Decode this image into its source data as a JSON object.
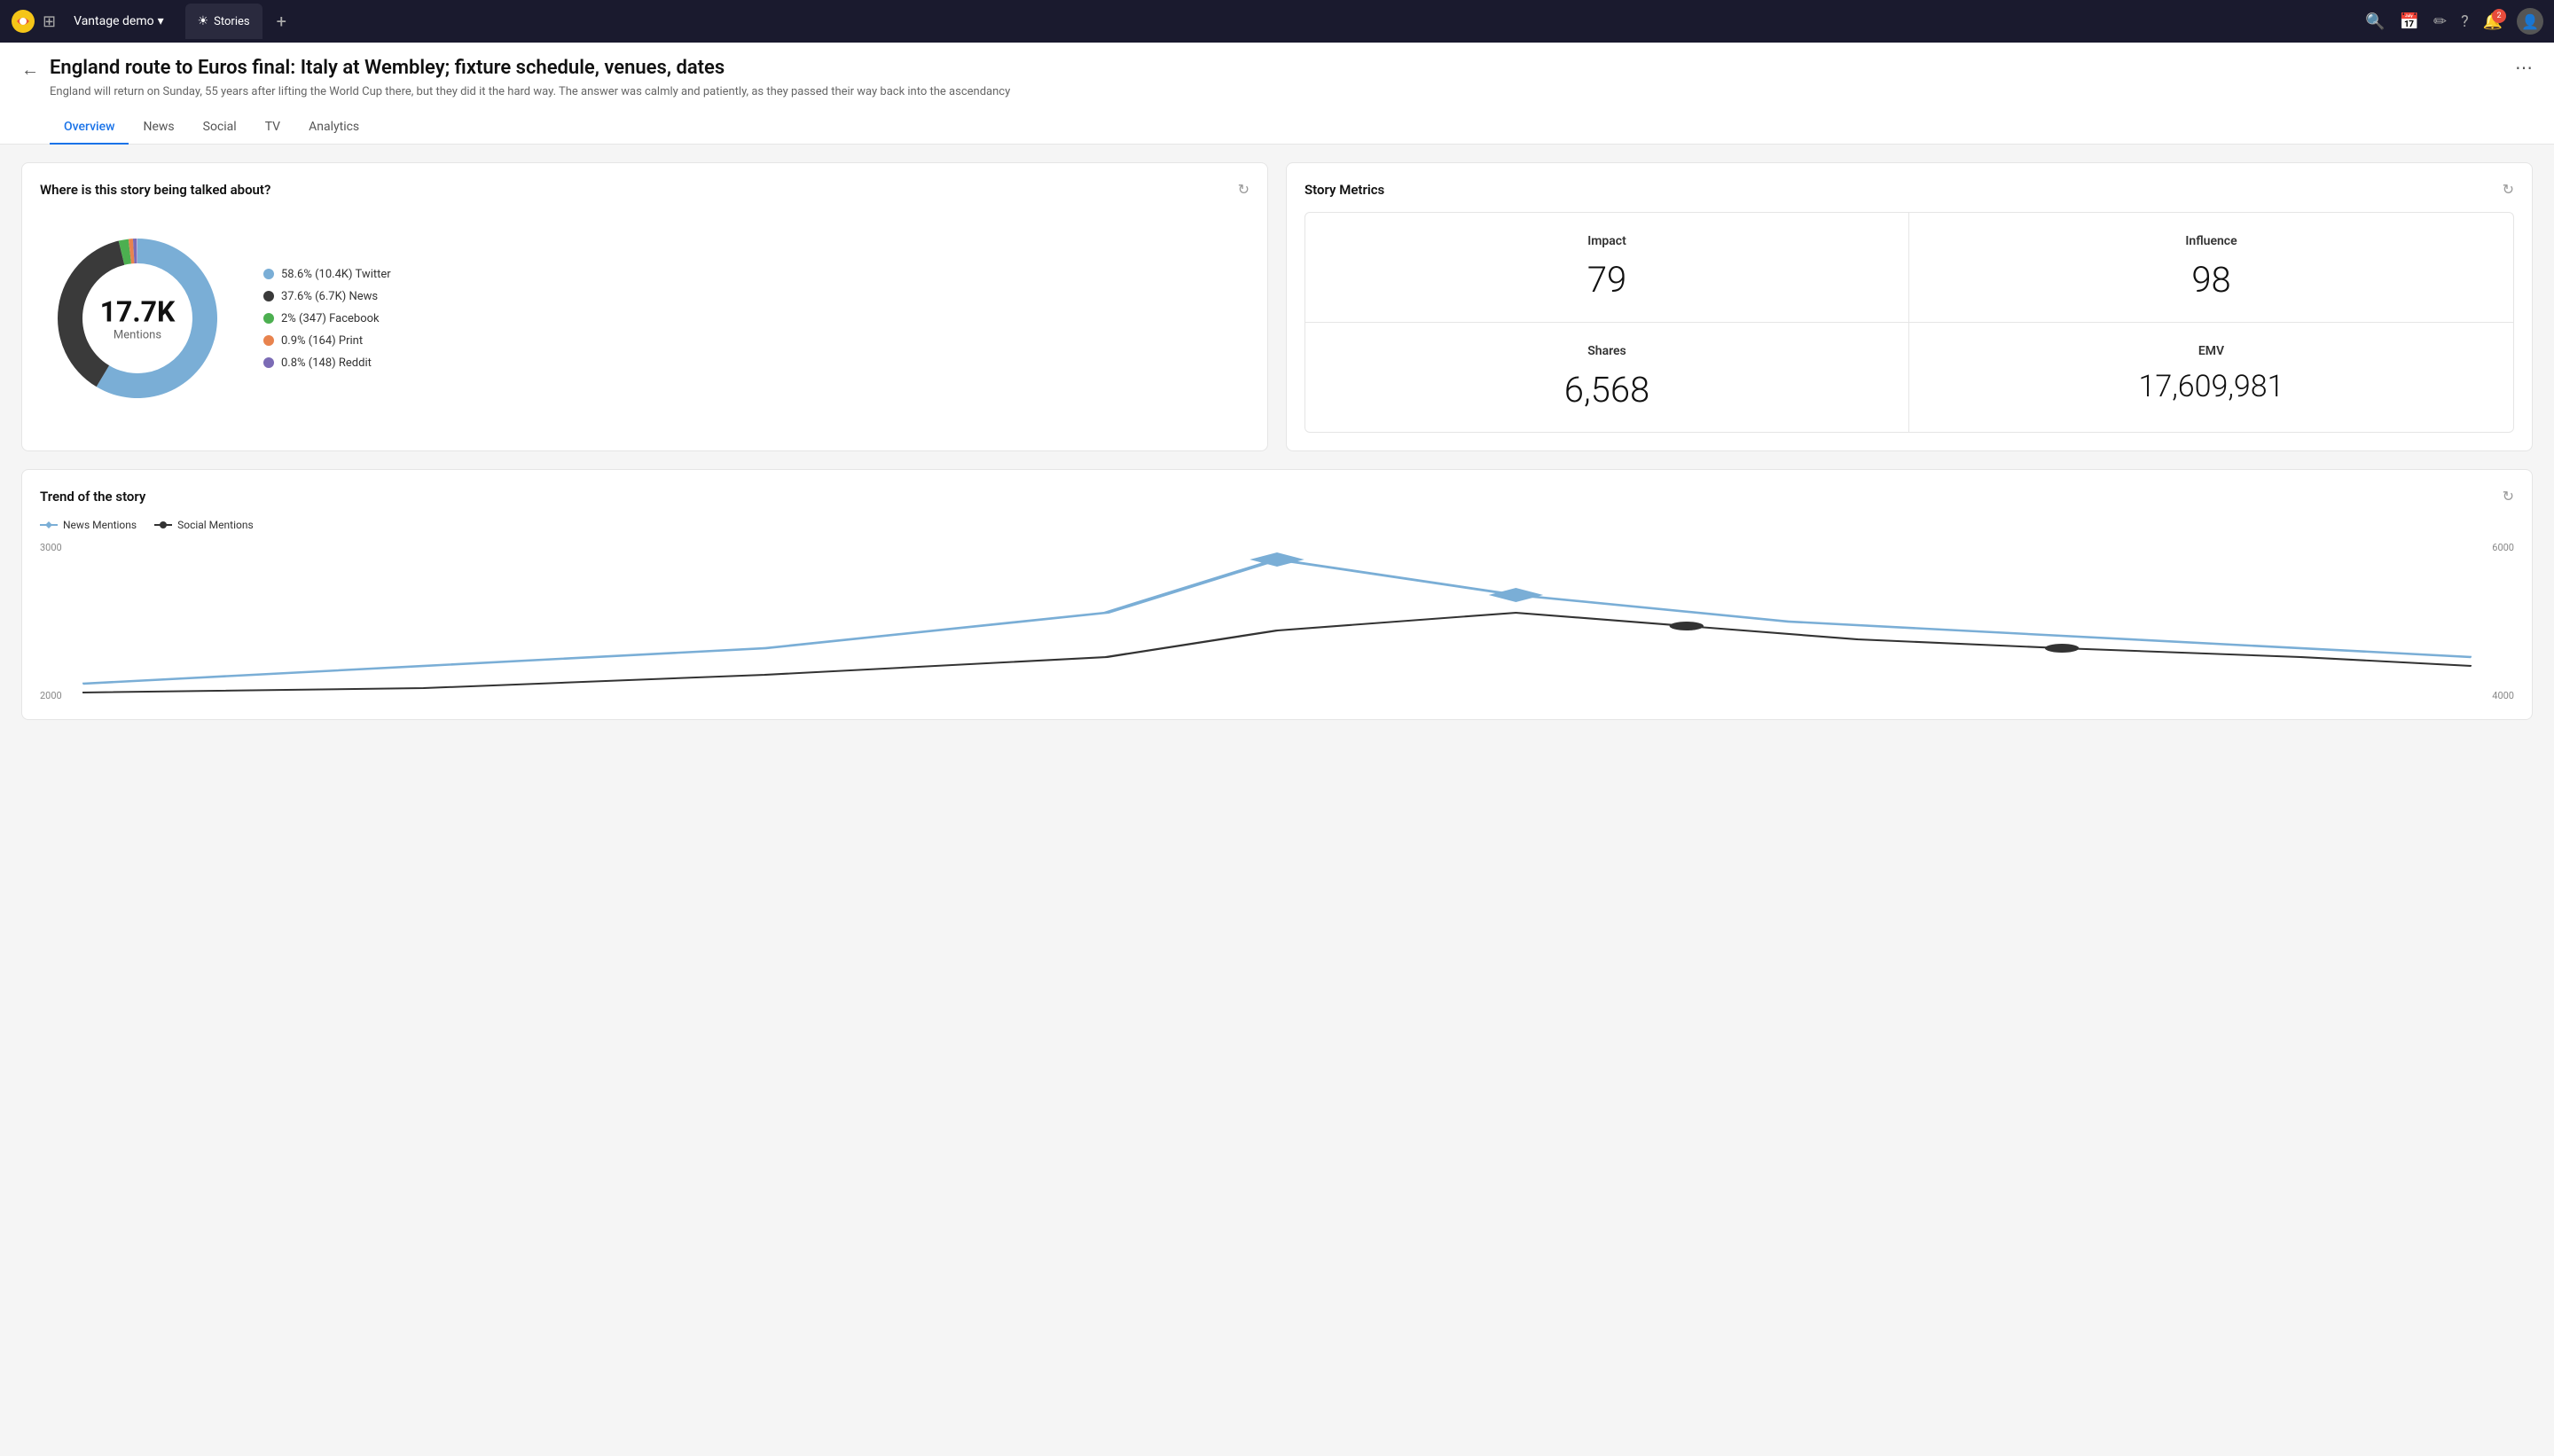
{
  "topnav": {
    "workspace": "Vantage demo",
    "chevron": "▾",
    "tab_icon": "☀",
    "tab_label": "Stories",
    "add_label": "+",
    "grid_label": "⋮⋮⋮",
    "search_icon": "🔍",
    "calendar_icon": "📅",
    "edit_icon": "✏",
    "help_icon": "?",
    "notif_icon": "🔔",
    "notif_count": "2",
    "avatar_icon": "👤"
  },
  "header": {
    "title": "England route to Euros final: Italy at Wembley; fixture schedule, venues, dates",
    "subtitle": "England will return on Sunday, 55 years after lifting the World Cup there, but they did it the hard way. The answer was calmly and patiently, as they passed their way back into the ascendancy",
    "more_icon": "⋯"
  },
  "tabs": [
    {
      "label": "Overview",
      "active": true
    },
    {
      "label": "News",
      "active": false
    },
    {
      "label": "Social",
      "active": false
    },
    {
      "label": "TV",
      "active": false
    },
    {
      "label": "Analytics",
      "active": false
    }
  ],
  "donut_card": {
    "title": "Where is this story being talked about?",
    "refresh_icon": "↻",
    "center_value": "17.7K",
    "center_label": "Mentions",
    "legend": [
      {
        "color": "#7aaed6",
        "label": "58.6% (10.4K)  Twitter"
      },
      {
        "color": "#3a3a3a",
        "label": "37.6% (6.7K)  News"
      },
      {
        "color": "#4caf50",
        "label": "2% (347)  Facebook"
      },
      {
        "color": "#e8834e",
        "label": "0.9% (164)  Print"
      },
      {
        "color": "#7b6bb5",
        "label": "0.8% (148)  Reddit"
      }
    ],
    "segments": [
      {
        "pct": 58.6,
        "color": "#7aaed6"
      },
      {
        "pct": 37.6,
        "color": "#3a3a3a"
      },
      {
        "pct": 2.0,
        "color": "#4caf50"
      },
      {
        "pct": 0.9,
        "color": "#e8834e"
      },
      {
        "pct": 0.8,
        "color": "#7b6bb5"
      }
    ]
  },
  "metrics_card": {
    "title": "Story Metrics",
    "refresh_icon": "↻",
    "cells": [
      {
        "name": "Impact",
        "value": "79"
      },
      {
        "name": "Influence",
        "value": "98"
      },
      {
        "name": "Shares",
        "value": "6,568"
      },
      {
        "name": "EMV",
        "value": "17,609,981"
      }
    ]
  },
  "trend_card": {
    "title": "Trend of the story",
    "refresh_icon": "↻",
    "legend": [
      {
        "label": "News Mentions",
        "type": "diamond",
        "color": "#7aaed6"
      },
      {
        "label": "Social Mentions",
        "type": "dot",
        "color": "#333"
      }
    ],
    "yaxis_left": [
      "3000",
      "2000"
    ],
    "yaxis_right": [
      "6000",
      "4000"
    ]
  }
}
